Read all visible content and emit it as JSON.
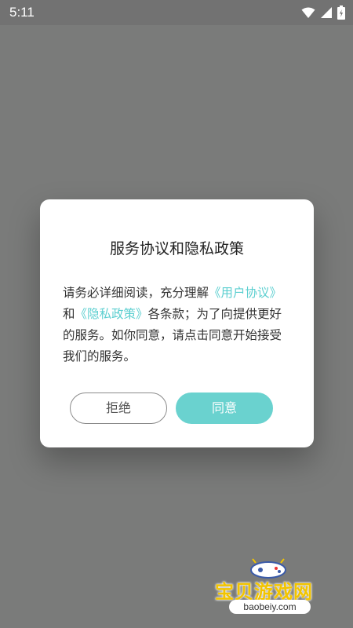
{
  "status_bar": {
    "time": "5:11",
    "icons": [
      "wifi-icon",
      "signal-icon",
      "battery-icon"
    ]
  },
  "dialog": {
    "title": "服务协议和隐私政策",
    "body_parts": {
      "p1": "请务必详细阅读，充分理解",
      "link_user": "《用户协议》",
      "p2": "和",
      "link_privacy": "《隐私政策》",
      "p3": "各条款；为了向提供更好的服务。如你同意，请点击同意开始接受我们的服务。"
    },
    "refuse_label": "拒绝",
    "agree_label": "同意"
  },
  "watermark": {
    "name": "宝贝游戏网",
    "url": "baobeiy.com"
  },
  "colors": {
    "accent": "#6ad2cf",
    "link": "#5ccfd0",
    "backdrop": "#7a7b7a"
  }
}
